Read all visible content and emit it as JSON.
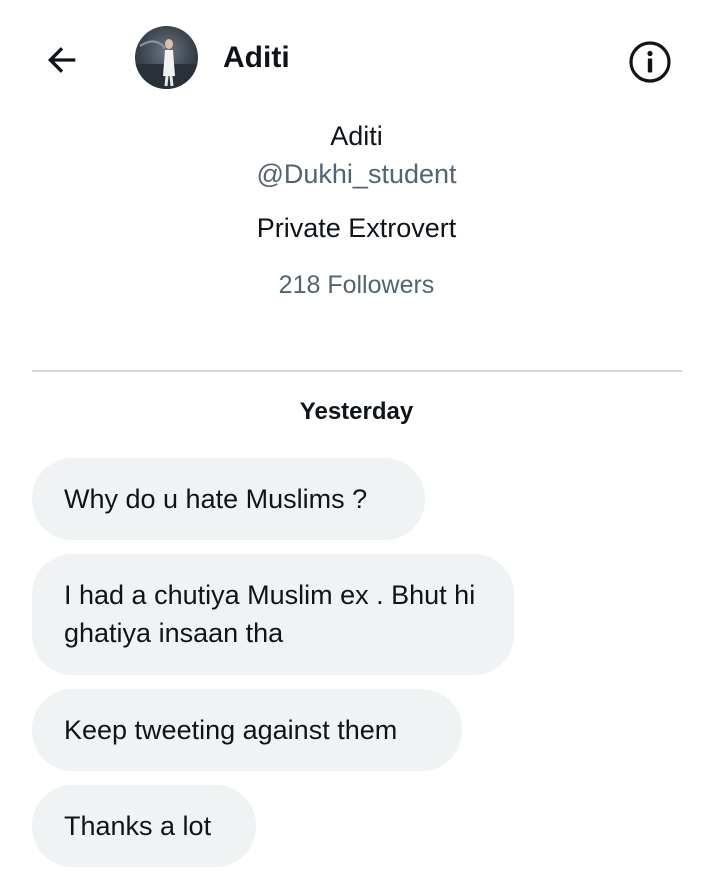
{
  "header": {
    "back_icon": "arrow-left-icon",
    "title": "Aditi",
    "info_icon": "info-icon"
  },
  "profile": {
    "name": "Aditi",
    "handle": "@Dukhi_student",
    "bio": "Private Extrovert",
    "followers": "218 Followers"
  },
  "conversation": {
    "date_label": "Yesterday",
    "messages": [
      {
        "text": "Why do u hate Muslims ?"
      },
      {
        "text": "I had a chutiya Muslim ex . Bhut hi ghatiya insaan tha"
      },
      {
        "text": "Keep tweeting against them"
      },
      {
        "text": "Thanks a lot"
      }
    ]
  },
  "colors": {
    "bubble_bg": "#eff3f4",
    "secondary_text": "#536471",
    "divider": "#cfd9de"
  }
}
